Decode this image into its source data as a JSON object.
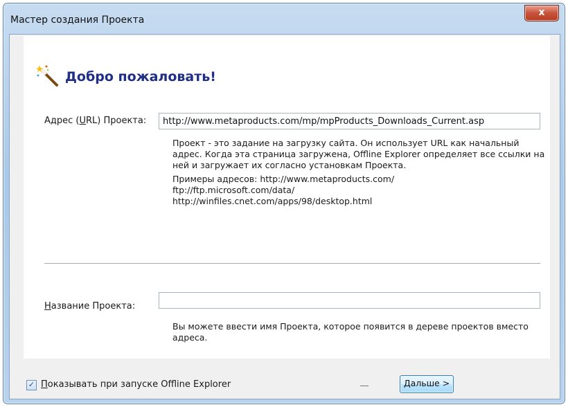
{
  "window": {
    "title": "Мастер создания Проекта",
    "close_glyph": "x"
  },
  "header": {
    "icon": "magic-wand-icon",
    "title": "Добро пожаловать!"
  },
  "url": {
    "label_pre": "Адрес (",
    "label_mnemonic": "U",
    "label_post": "RL) Проекта:",
    "value": "http://www.metaproducts.com/mp/mpProducts_Downloads_Current.asp",
    "help": "Проект - это задание на загрузку сайта. Он использует URL как начальный адрес. Когда эта страница загружена, Offline Explorer определяет все ссылки на ней и загружает их согласно установкам Проекта.",
    "examples_line1": "Примеры адресов: http://www.metaproducts.com/",
    "examples_line2": "ftp://ftp.microsoft.com/data/",
    "examples_line3": "http://winfiles.cnet.com/apps/98/desktop.html"
  },
  "name": {
    "label_mnemonic": "Н",
    "label_post": "азвание Проекта:",
    "value": "",
    "help": "Вы можете ввести имя Проекта, которое появится в дереве проектов вместо адреса."
  },
  "footer": {
    "checkbox_checked": true,
    "checkbox_mnemonic": "П",
    "checkbox_label_post": "оказывать при запуске Offline Explorer",
    "next_mnemonic": "Д",
    "next_post": "альше >"
  },
  "colors": {
    "heading": "#1e2f85",
    "frame": "#aac8e8",
    "close_button": "#c7533a"
  }
}
